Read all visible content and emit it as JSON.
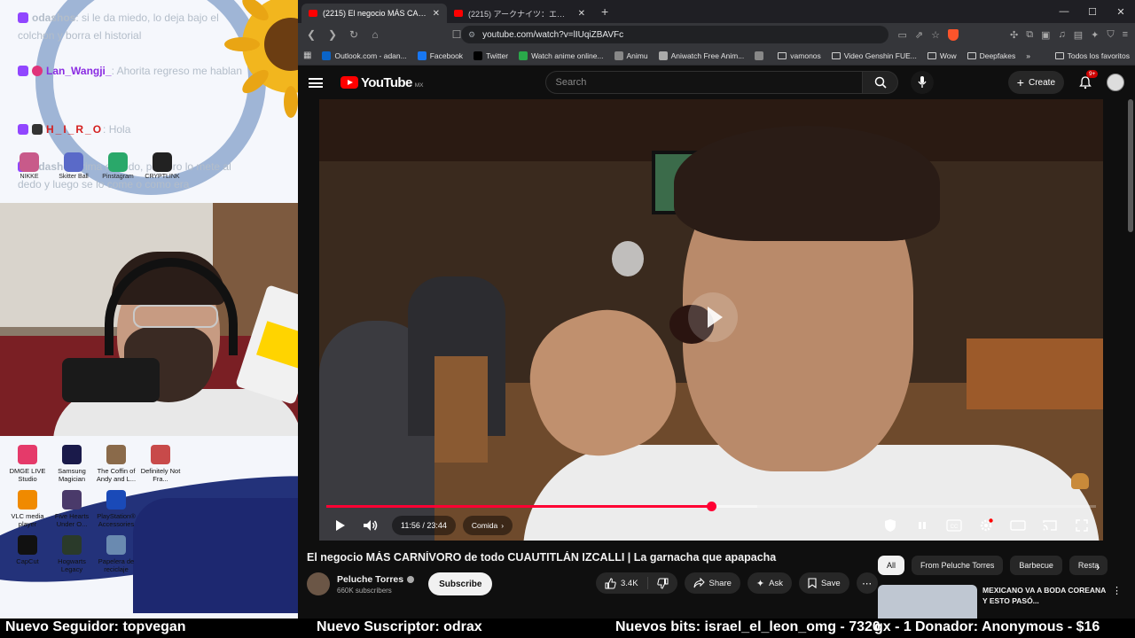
{
  "overlay": {
    "chat": [
      {
        "name": "odashos",
        "text": ": si le da miedo, lo deja bajo el colchon y borra el historial",
        "name_color": "#b3bdc9"
      },
      {
        "name": "Lan_Wangji_",
        "text": ": Ahorita regreso me hablan",
        "name_color": "#8a2be2"
      },
      {
        "name": "H_I_R_O",
        "text": ": Hola",
        "name_color": "#d41f1f"
      },
      {
        "name": "odashos",
        "text": ": rima el dedo, primero lo mete al dedo y luego se lo come o como era",
        "name_color": "#b3bdc9"
      }
    ],
    "tray_items": [
      {
        "label": "NIKKE",
        "color": "#c85a8a"
      },
      {
        "label": "Skitter Ball",
        "color": "#5a6ac8"
      },
      {
        "label": "Pinstagram",
        "color": "#2aa86a"
      },
      {
        "label": "CRYPTLINK",
        "color": "#222222"
      }
    ],
    "desktop_icons": [
      {
        "label": "DMGE LIVE Studio",
        "color": "#e53a6a"
      },
      {
        "label": "Samsung Magician",
        "color": "#1a1a4a"
      },
      {
        "label": "The Coffin of Andy and L...",
        "color": "#8a6a4a"
      },
      {
        "label": "Definitely Not Fra...",
        "color": "#c84a4a"
      },
      {
        "label": "VLC media player",
        "color": "#f08a00"
      },
      {
        "label": "Five Hearts Under O...",
        "color": "#4a3a6a"
      },
      {
        "label": "PlayStation® Accessories",
        "color": "#1a4ab8"
      },
      {
        "label": "",
        "color": ""
      },
      {
        "label": "CapCut",
        "color": "#111111"
      },
      {
        "label": "Hogwarts Legacy",
        "color": "#2a3a2a"
      },
      {
        "label": "Papelera de reciclaje",
        "color": "#6a8ab0"
      },
      {
        "label": "",
        "color": ""
      }
    ]
  },
  "browser": {
    "tabs": [
      {
        "title": "(2215) El negocio MÁS CARNÍVORO de todo",
        "active": true
      },
      {
        "title": "(2215) アークナイツ：エンドフィールド - YouTube",
        "active": false
      }
    ],
    "url": "youtube.com/watch?v=lIUqiZBAVFc",
    "bookmarks": [
      {
        "label": "Outlook.com - adan...",
        "color": "#0a64c8",
        "type": "site"
      },
      {
        "label": "Facebook",
        "color": "#1877f2",
        "type": "site"
      },
      {
        "label": "Twitter",
        "color": "#000000",
        "type": "site"
      },
      {
        "label": "Watch anime online...",
        "color": "#2aa84a",
        "type": "site"
      },
      {
        "label": "Animu",
        "color": "#888888",
        "type": "site"
      },
      {
        "label": "Aniwatch Free Anim...",
        "color": "#aaaaaa",
        "type": "site"
      },
      {
        "label": "",
        "color": "#888888",
        "type": "site"
      },
      {
        "label": "vamonos",
        "color": "",
        "type": "folder"
      },
      {
        "label": "Video Genshin FUE...",
        "color": "",
        "type": "folder"
      },
      {
        "label": "Wow",
        "color": "",
        "type": "folder"
      },
      {
        "label": "Deepfakes",
        "color": "",
        "type": "folder"
      }
    ],
    "all_bookmarks": "Todos los favoritos"
  },
  "youtube": {
    "logo": "YouTube",
    "country": "MX",
    "search_placeholder": "Search",
    "create_label": "Create",
    "notifications": "9+",
    "player": {
      "current_time": "11:56",
      "duration": "23:44",
      "time_display": "11:56 / 23:44",
      "chapter": "Comida",
      "progress": 0.5
    },
    "video_title": "El negocio MÁS CARNÍVORO de todo CUAUTITLÁN IZCALLI | La garnacha que apapacha",
    "channel": {
      "name": "Peluche Torres",
      "subscribers": "660K subscribers",
      "subscribe_label": "Subscribe"
    },
    "actions": {
      "likes": "3.4K",
      "share": "Share",
      "ask": "Ask",
      "save": "Save"
    },
    "chips": [
      "All",
      "From Peluche Torres",
      "Barbecue",
      "Resta"
    ],
    "recommendation": {
      "title": "MEXICANO VA A BODA COREANA Y ESTO PASÓ..."
    }
  },
  "ticker": [
    {
      "text": "Nuevo Seguidor: topvegan"
    },
    {
      "text": "Nuevo Suscriptor: odrax"
    },
    {
      "text": "Nuevos bits: israel_el_leon_omg - 7320"
    },
    {
      "text": "gx - 1"
    },
    {
      "text": "Donador: Anonymous - $16"
    }
  ],
  "colors": {
    "accent": "#ff0033",
    "yt_bg": "#0f0f0f",
    "brand_red": "#ff0000"
  }
}
